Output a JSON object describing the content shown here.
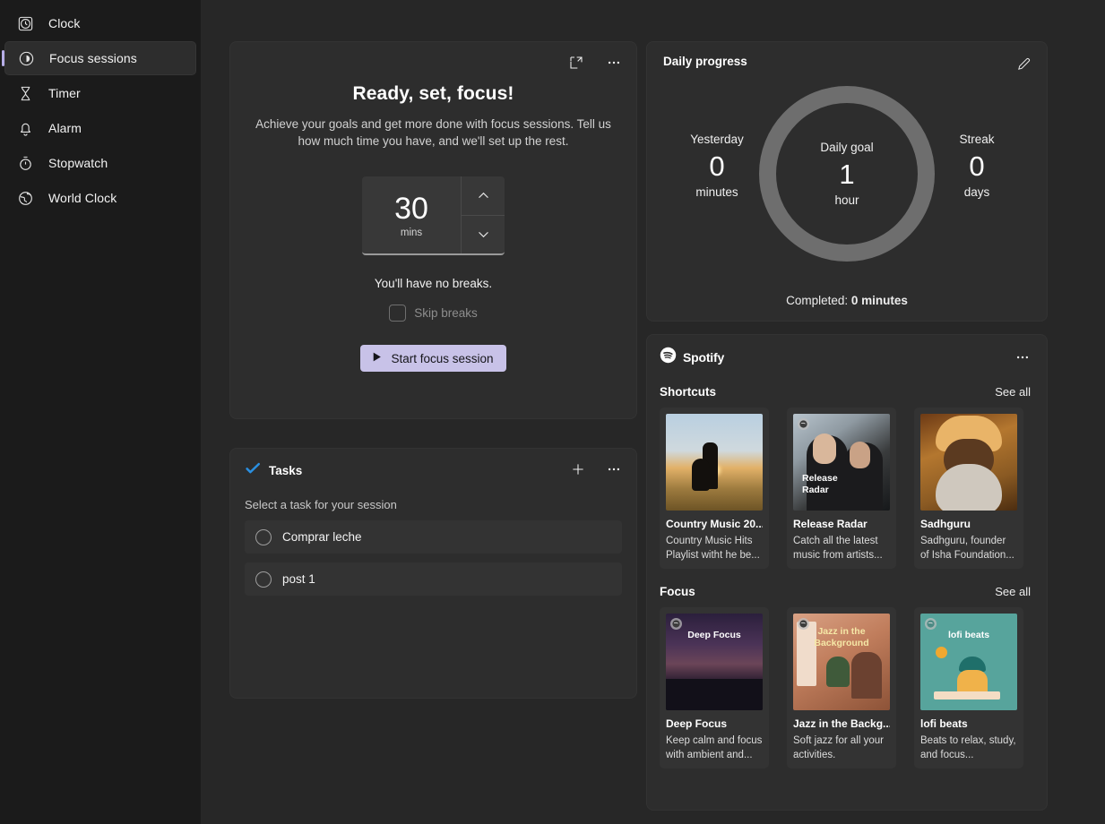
{
  "sidebar": {
    "items": [
      {
        "label": "Clock",
        "icon": "clock-icon",
        "active": false
      },
      {
        "label": "Focus sessions",
        "icon": "focus-sessions-icon",
        "active": true
      },
      {
        "label": "Timer",
        "icon": "hourglass-icon",
        "active": false
      },
      {
        "label": "Alarm",
        "icon": "bell-icon",
        "active": false
      },
      {
        "label": "Stopwatch",
        "icon": "stopwatch-icon",
        "active": false
      },
      {
        "label": "World Clock",
        "icon": "globe-icon",
        "active": false
      }
    ]
  },
  "focus_card": {
    "mini_view_icon": "mini-view-icon",
    "more_icon": "more-options-icon",
    "title": "Ready, set, focus!",
    "subtitle": "Achieve your goals and get more done with focus sessions. Tell us how much time you have, and we'll set up the rest.",
    "spinner": {
      "value": "30",
      "unit": "mins",
      "up_icon": "chevron-up-icon",
      "down_icon": "chevron-down-icon"
    },
    "breaks_text": "You'll have no breaks.",
    "skip_breaks_label": "Skip breaks",
    "skip_breaks_checked": false,
    "start_button": "Start focus session",
    "start_button_color": "#c8c2e8",
    "play_icon": "play-icon"
  },
  "tasks_card": {
    "icon": "todo-check-icon",
    "icon_color": "#2a8fe0",
    "title": "Tasks",
    "add_icon": "plus-icon",
    "more_icon": "more-options-icon",
    "hint": "Select a task for your session",
    "items": [
      {
        "label": "Comprar leche",
        "checked": false
      },
      {
        "label": "post 1",
        "checked": false
      }
    ]
  },
  "daily_progress": {
    "title": "Daily progress",
    "edit_icon": "pencil-edit-icon",
    "ring_color": "#6e6e6e",
    "yesterday": {
      "label": "Yesterday",
      "value": "0",
      "unit": "minutes"
    },
    "daily_goal": {
      "label": "Daily goal",
      "value": "1",
      "unit": "hour"
    },
    "streak": {
      "label": "Streak",
      "value": "0",
      "unit": "days"
    },
    "completed_prefix": "Completed: ",
    "completed_value": "0 minutes"
  },
  "spotify": {
    "logo_icon": "spotify-icon",
    "logo_text": "Spotify",
    "more_icon": "more-options-icon",
    "sections": [
      {
        "title": "Shortcuts",
        "see_all": "See all",
        "tiles": [
          {
            "title": "Country Music 20...",
            "desc": "Country Music Hits Playlist witht he be...",
            "art": "art-country",
            "art_text": "",
            "badge": false
          },
          {
            "title": "Release Radar",
            "desc": "Catch all the latest music from artists...",
            "art": "art-release",
            "art_text": "Release\nRadar",
            "badge": true
          },
          {
            "title": "Sadhguru",
            "desc": "Sadhguru, founder of Isha Foundation...",
            "art": "art-sadhguru",
            "art_text": "",
            "badge": false
          }
        ]
      },
      {
        "title": "Focus",
        "see_all": "See all",
        "tiles": [
          {
            "title": "Deep Focus",
            "desc": "Keep calm and focus with ambient and...",
            "art": "art-deep",
            "art_text": "Deep Focus",
            "badge": true
          },
          {
            "title": "Jazz in the Backg...",
            "desc": "Soft jazz for all your activities.",
            "art": "art-jazz",
            "art_text": "Jazz in the\nBackground",
            "badge": true
          },
          {
            "title": "lofi beats",
            "desc": "Beats to relax, study, and focus...",
            "art": "art-lofi",
            "art_text": "lofi beats",
            "badge": true
          }
        ]
      }
    ]
  }
}
